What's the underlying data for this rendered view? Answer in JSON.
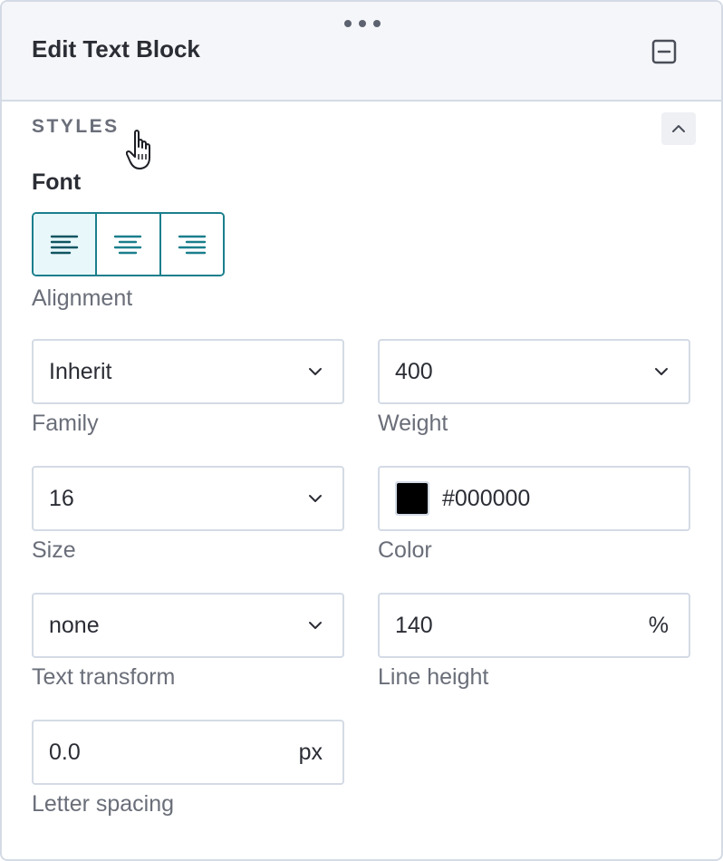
{
  "header": {
    "title": "Edit Text Block"
  },
  "styles_section": {
    "label": "STYLES"
  },
  "font": {
    "heading": "Font",
    "alignment": {
      "label": "Alignment",
      "options": [
        "left",
        "center",
        "right"
      ],
      "selected": "left"
    },
    "family": {
      "value": "Inherit",
      "label": "Family"
    },
    "weight": {
      "value": "400",
      "label": "Weight"
    },
    "size": {
      "value": "16",
      "label": "Size"
    },
    "color": {
      "value": "#000000",
      "swatch": "#000000",
      "label": "Color"
    },
    "text_transform": {
      "value": "none",
      "label": "Text transform"
    },
    "line_height": {
      "value": "140",
      "unit": "%",
      "label": "Line height"
    },
    "letter_spacing": {
      "value": "0.0",
      "unit": "px",
      "label": "Letter spacing"
    }
  },
  "icons": {
    "drag": "drag-handle-dots-icon",
    "collapse": "minus-square-icon",
    "section_toggle": "chevron-up-icon",
    "dropdown": "chevron-down-icon",
    "cursor": "hand-pointer-icon"
  },
  "colors": {
    "accent": "#1a7f8c",
    "accent_bg": "#e8f7fa",
    "border": "#d4dbe5",
    "header_bg": "#f5f6f9",
    "text": "#2b2d35",
    "muted": "#6a6e79"
  }
}
